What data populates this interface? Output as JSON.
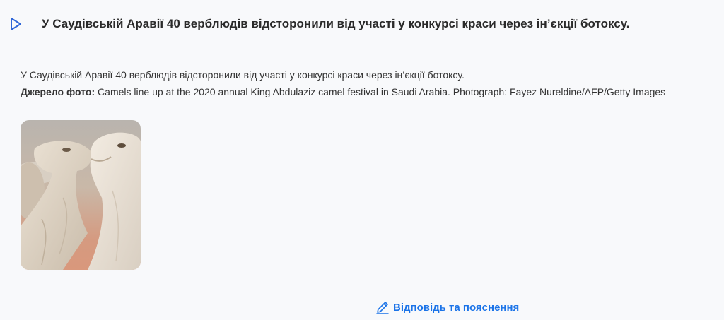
{
  "question": {
    "title": "У Саудівській Аравії 40 верблюдів відсторонили від участі у конкурсі краси через ін’єкції ботоксу.",
    "text": "У Саудівській Аравії 40 верблюдів відсторонили від участі у конкурсі краси через ін’єкції ботоксу.",
    "source_label": "Джерело фото:",
    "source_text": "Camels line up at the 2020 annual King Abdulaziz camel festival in Saudi Arabia. Photograph: Fayez Nureldine/AFP/Getty Images"
  },
  "photo": {
    "subject": "camels"
  },
  "answer_link": {
    "label": "Відповідь та пояснення"
  },
  "colors": {
    "accent": "#1a73e8",
    "play_icon": "#2f66d8",
    "background": "#f8f9fb"
  },
  "icons": {
    "play": "play-outline-icon",
    "pencil": "pencil-icon"
  }
}
